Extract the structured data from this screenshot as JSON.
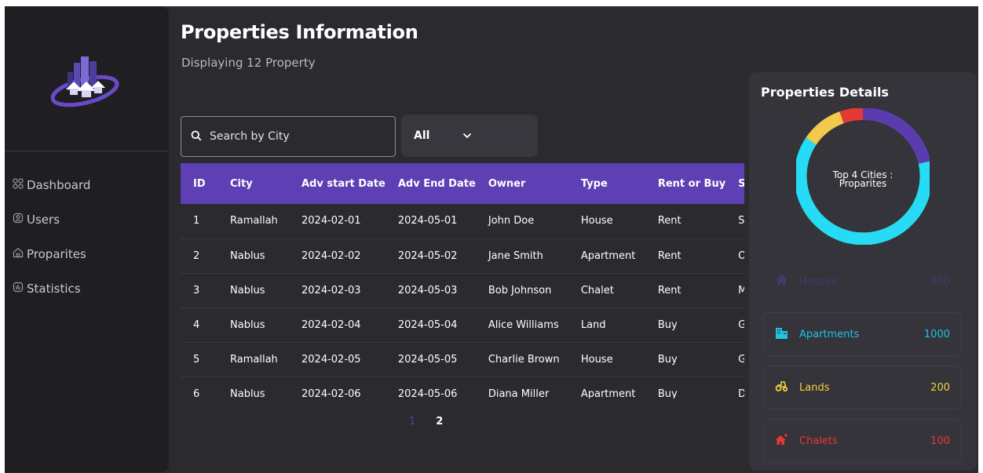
{
  "sidebar": {
    "items": [
      {
        "label": "Dashboard",
        "icon": "dashboard-icon"
      },
      {
        "label": "Users",
        "icon": "users-icon"
      },
      {
        "label": "Proparites",
        "icon": "home-icon"
      },
      {
        "label": "Statistics",
        "icon": "chart-icon"
      }
    ]
  },
  "header": {
    "title": "Properties Information",
    "subtitle": "Displaying 12 Property"
  },
  "search": {
    "placeholder": "Search by City"
  },
  "filter": {
    "value": "All"
  },
  "table": {
    "columns": [
      "ID",
      "City",
      "Adv start Date",
      "Adv End Date",
      "Owner",
      "Type",
      "Rent or Buy",
      "S"
    ],
    "rows": [
      [
        "1",
        "Ramallah",
        "2024-02-01",
        "2024-05-01",
        "John Doe",
        "House",
        "Rent",
        "Su"
      ],
      [
        "2",
        "Nablus",
        "2024-02-02",
        "2024-05-02",
        "Jane Smith",
        "Apartment",
        "Rent",
        "O"
      ],
      [
        "3",
        "Nablus",
        "2024-02-03",
        "2024-05-03",
        "Bob Johnson",
        "Chalet",
        "Rent",
        "M"
      ],
      [
        "4",
        "Nablus",
        "2024-02-04",
        "2024-05-04",
        "Alice Williams",
        "Land",
        "Buy",
        "G"
      ],
      [
        "5",
        "Ramallah",
        "2024-02-05",
        "2024-05-05",
        "Charlie Brown",
        "House",
        "Buy",
        "G"
      ],
      [
        "6",
        "Nablus",
        "2024-02-06",
        "2024-05-06",
        "Diana Miller",
        "Apartment",
        "Buy",
        "D"
      ]
    ]
  },
  "pagination": {
    "pages": [
      "1",
      "2"
    ],
    "current": "1"
  },
  "panel": {
    "title": "Properties Details",
    "donut_label_line1": "Top 4 Cities :",
    "donut_label_line2": "Proparites",
    "donut_colors": [
      "#5b3cb0",
      "#27dbf5",
      "#f2c94c",
      "#e53935"
    ],
    "cards": [
      {
        "label": "Houses",
        "value": "400",
        "color": "#5b3cb0",
        "icon": "house-icon"
      },
      {
        "label": "Apartments",
        "value": "1000",
        "color": "#20c5e0",
        "icon": "building-icon"
      },
      {
        "label": "Lands",
        "value": "200",
        "color": "#f5d33d",
        "icon": "tractor-icon"
      },
      {
        "label": "Chalets",
        "value": "100",
        "color": "#e53935",
        "icon": "chalet-icon"
      }
    ]
  }
}
